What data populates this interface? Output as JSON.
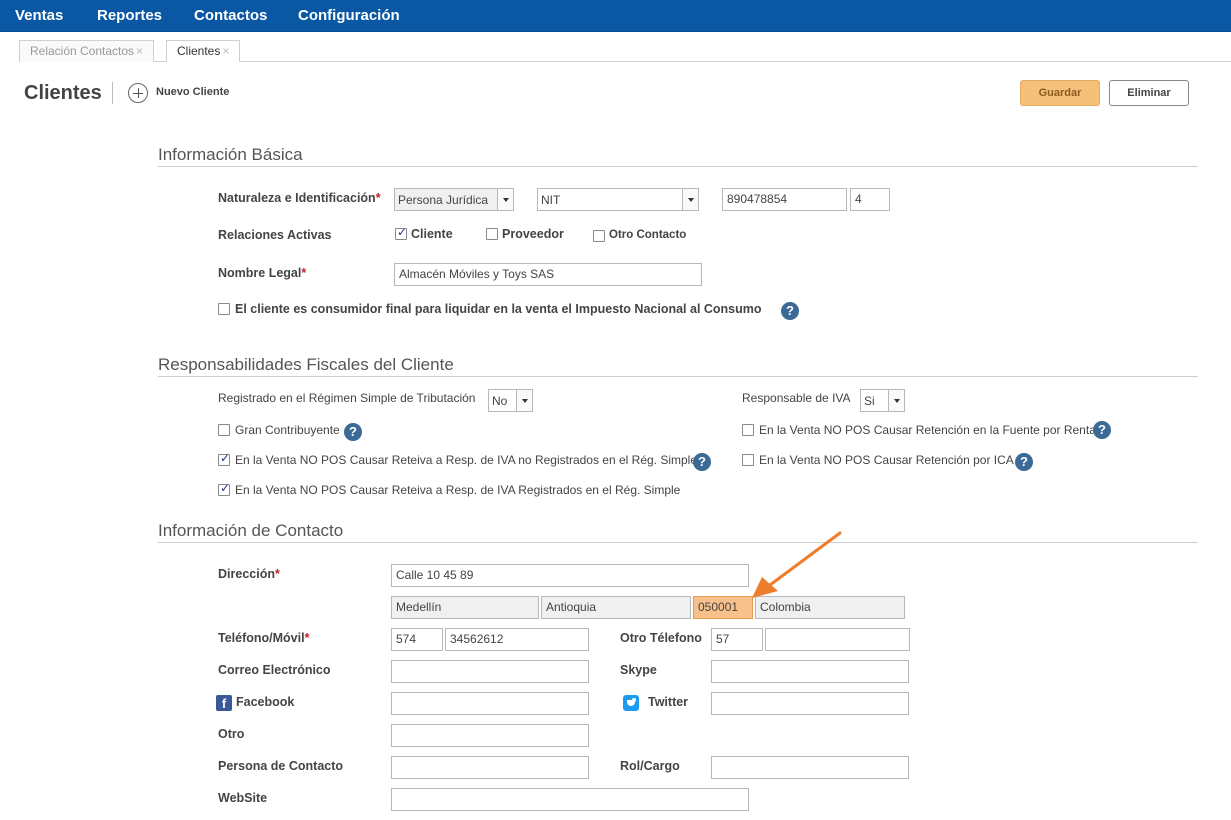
{
  "nav": {
    "ventas": "Ventas",
    "reportes": "Reportes",
    "contactos": "Contactos",
    "configuracion": "Configuración"
  },
  "tabs": [
    {
      "label": "Relación Contactos",
      "close": "×"
    },
    {
      "label": "Clientes",
      "close": "×"
    }
  ],
  "header": {
    "title": "Clientes",
    "new_label": "Nuevo Cliente",
    "save_label": "Guardar",
    "delete_label": "Eliminar"
  },
  "basic": {
    "section_title": "Información Básica",
    "naturaleza_label": "Naturaleza e Identificación",
    "required_mark": "*",
    "tipo_persona": "Persona Jurídica",
    "tipo_documento": "NIT",
    "numero_documento": "890478854",
    "digito_verificacion": "4",
    "relaciones_label": "Relaciones Activas",
    "rel_cliente": "Cliente",
    "rel_proveedor": "Proveedor",
    "rel_otro": "Otro Contacto",
    "nombre_legal_label": "Nombre Legal",
    "nombre_legal": "Almacén Móviles y Toys SAS",
    "consumidor_final": "El cliente es consumidor final para liquidar en la venta el Impuesto Nacional al Consumo"
  },
  "fiscal": {
    "section_title": "Responsabilidades Fiscales del Cliente",
    "regimen_label": "Registrado en el Régimen Simple de Tributación",
    "regimen_value": "No",
    "iva_label": "Responsable de IVA",
    "iva_value": "Si",
    "gran_contribuyente": "Gran Contribuyente",
    "retencion_fuente": "En la Venta NO POS Causar Retención en la Fuente por Renta",
    "reteiva_no_reg": "En la Venta NO POS Causar Reteiva a Resp. de IVA no Registrados en el Rég. Simple",
    "retencion_ica": "En la Venta NO POS Causar Retención por ICA",
    "reteiva_reg": "En la Venta NO POS Causar Reteiva a Resp. de IVA Registrados en el Rég. Simple"
  },
  "contact": {
    "section_title": "Información de Contacto",
    "direccion_label": "Dirección",
    "direccion": "Calle 10 45 89",
    "ciudad": "Medellín",
    "departamento": "Antioquia",
    "codigo_postal": "050001",
    "pais": "Colombia",
    "telefono_label": "Teléfono/Móvil",
    "telefono_indicativo": "574",
    "telefono_numero": "34562612",
    "otro_telefono_label": "Otro Télefono",
    "otro_telefono_indicativo": "57",
    "otro_telefono_numero": "",
    "correo_label": "Correo Electrónico",
    "correo": "",
    "skype_label": "Skype",
    "skype": "",
    "facebook_label": "Facebook",
    "facebook": "",
    "twitter_label": "Twitter",
    "twitter": "",
    "otro_label": "Otro",
    "otro": "",
    "persona_contacto_label": "Persona de Contacto",
    "persona_contacto": "",
    "rol_label": "Rol/Cargo",
    "rol": "",
    "website_label": "WebSite",
    "website": ""
  },
  "icons": {
    "help": "question-circle-icon",
    "add": "plus-circle-icon",
    "facebook": "facebook-icon",
    "twitter": "twitter-icon",
    "annotation": "orange-arrow"
  },
  "colors": {
    "navbar": "#0a57a4",
    "save_button": "#f5c07a",
    "highlight": "#f8c08a",
    "annotation_arrow": "#ee7d2b",
    "help_icon": "#3c6a97"
  }
}
